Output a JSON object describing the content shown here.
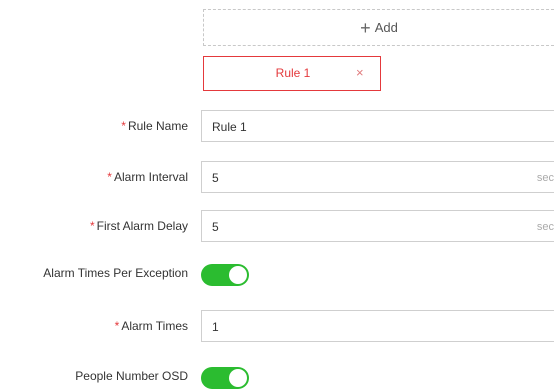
{
  "add_button": {
    "label": "Add",
    "icon": "plus-icon"
  },
  "rule_tabs": [
    {
      "label": "Rule 1",
      "close_glyph": "×",
      "active": true
    }
  ],
  "form": {
    "rule_name": {
      "label": "Rule Name",
      "required": "*",
      "value": "Rule 1"
    },
    "alarm_interval": {
      "label": "Alarm Interval",
      "required": "*",
      "value": "5",
      "unit": "sec"
    },
    "first_alarm_delay": {
      "label": "First Alarm Delay",
      "required": "*",
      "value": "5",
      "unit": "sec"
    },
    "alarm_times_per_exception": {
      "label": "Alarm Times Per Exception",
      "enabled": true
    },
    "alarm_times": {
      "label": "Alarm Times",
      "required": "*",
      "value": "1"
    },
    "people_number_osd": {
      "label": "People Number OSD",
      "enabled": true
    }
  },
  "colors": {
    "accent_red": "#e4393c",
    "toggle_on": "#2bbc30"
  }
}
